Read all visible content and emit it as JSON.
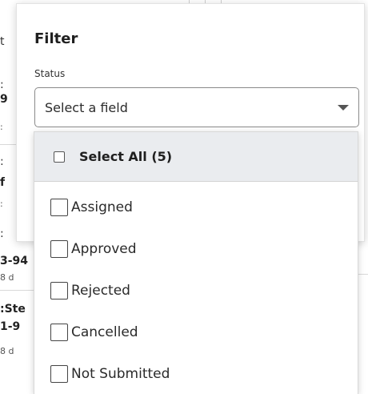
{
  "background": {
    "fragments": [
      "t",
      ":",
      "9",
      ":",
      ":",
      "f",
      ":",
      ":",
      "3-94",
      "8 d",
      ":Ste",
      "1-9",
      "8 d"
    ]
  },
  "filter": {
    "title": "Filter",
    "status_label": "Status",
    "select_placeholder": "Select a field",
    "select_all_label": "Select All (5)",
    "options": [
      {
        "label": "Assigned",
        "checked": false
      },
      {
        "label": "Approved",
        "checked": false
      },
      {
        "label": "Rejected",
        "checked": false
      },
      {
        "label": "Cancelled",
        "checked": false
      },
      {
        "label": "Not Submitted",
        "checked": false
      }
    ]
  }
}
